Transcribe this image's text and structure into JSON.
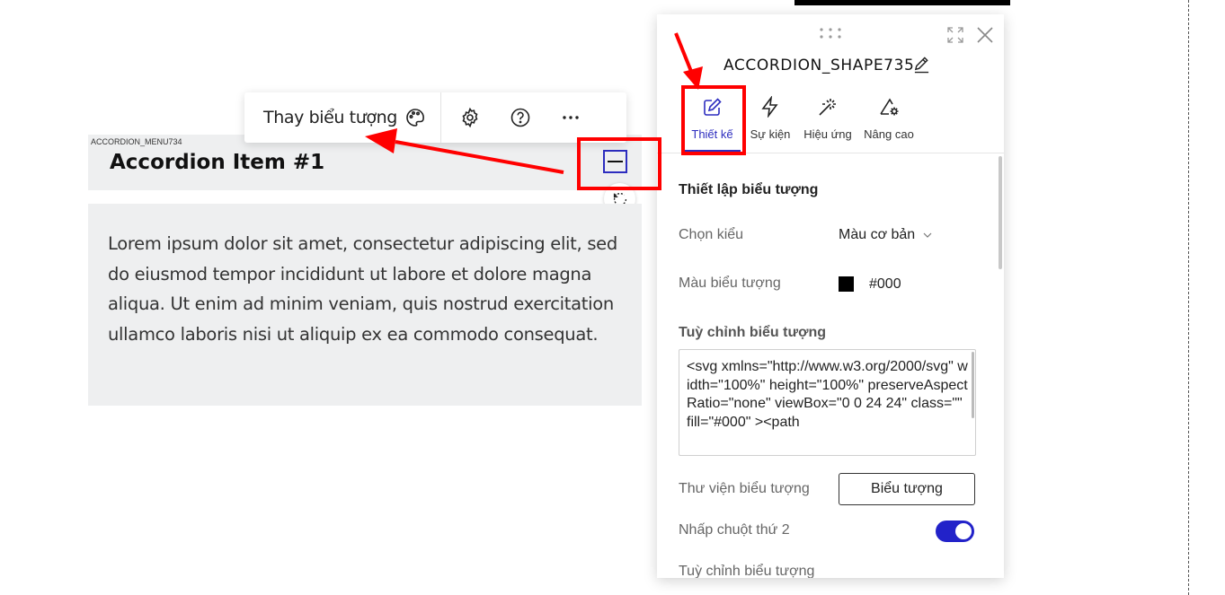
{
  "accordion": {
    "tag": "ACCORDION_MENU734",
    "title": "Accordion Item #1",
    "body": "Lorem ipsum dolor sit amet, consectetur adipiscing elit, sed do eiusmod tempor incididunt ut labore et dolore magna aliqua. Ut enim ad minim veniam, quis nostrud exercitation ullamco laboris nisi ut aliquip ex ea commodo consequat."
  },
  "toolbar": {
    "label": "Thay biểu tượng",
    "icons": [
      "palette-icon",
      "gear-icon",
      "help-icon",
      "more-icon"
    ]
  },
  "panel": {
    "title": "ACCORDION_SHAPE735",
    "tabs": [
      {
        "label": "Thiết kế",
        "icon": "edit-icon",
        "active": true
      },
      {
        "label": "Sự kiện",
        "icon": "lightning-icon",
        "active": false
      },
      {
        "label": "Hiệu ứng",
        "icon": "magic-wand-icon",
        "active": false
      },
      {
        "label": "Nâng cao",
        "icon": "advanced-settings-icon",
        "active": false
      }
    ],
    "section_title": "Thiết lập biểu tượng",
    "style_label": "Chọn kiểu",
    "style_value": "Màu cơ bản",
    "color_label": "Màu biểu tượng",
    "color_value": "#000",
    "custom_label": "Tuỳ chỉnh biểu tượng",
    "custom_code": "<svg xmlns=\"http://www.w3.org/2000/svg\" width=\"100%\" height=\"100%\" preserveAspectRatio=\"none\" viewBox=\"0 0 24 24\" class=\"\" fill=\"#000\" ><path",
    "library_label": "Thư viện biểu tượng",
    "library_button": "Biểu tượng",
    "second_click_label": "Nhấp chuột thứ 2",
    "second_click_enabled": true,
    "custom_label_2": "Tuỳ chỉnh biểu tượng"
  },
  "colors": {
    "accent": "#2d2dbf",
    "toggle": "#2222c9",
    "annotation": "#ff0000",
    "panel_bg": "#ffffff",
    "accordion_bg": "#eeeff0"
  }
}
